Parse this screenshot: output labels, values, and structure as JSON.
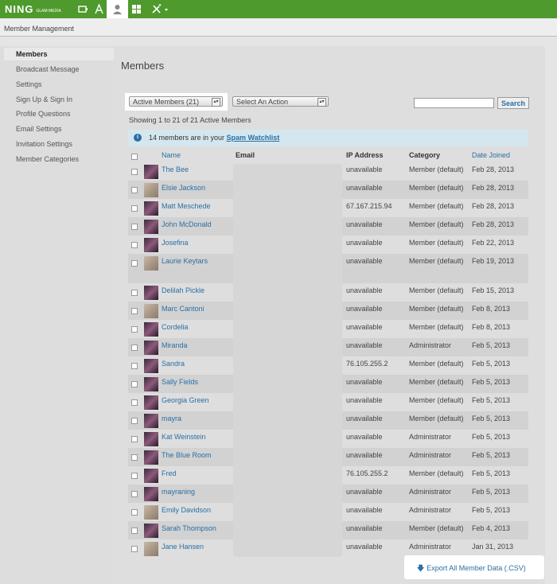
{
  "app": {
    "logo": "NING",
    "logo_sub": "GLAM MEDIA",
    "breadcrumb": "Member Management"
  },
  "sidebar": {
    "items": [
      {
        "label": "Members"
      },
      {
        "label": "Broadcast Message"
      },
      {
        "label": "Settings"
      },
      {
        "label": "Sign Up & Sign In"
      },
      {
        "label": "Profile Questions"
      },
      {
        "label": "Email Settings"
      },
      {
        "label": "Invitation Settings"
      },
      {
        "label": "Member Categories"
      }
    ]
  },
  "main": {
    "title": "Members",
    "filter": {
      "value": "Active Members (21)"
    },
    "action": {
      "value": "Select An Action"
    },
    "search": {
      "placeholder": "",
      "button": "Search"
    },
    "showing": "Showing 1 to 21 of 21 Active Members",
    "info": {
      "text": "14 members are in your ",
      "link": "Spam Watchlist"
    },
    "columns": {
      "name": "Name",
      "email": "Email",
      "ip": "IP Address",
      "category": "Category",
      "date": "Date Joined"
    },
    "members": [
      {
        "name": "The Bee",
        "ip": "unavailable",
        "category": "Member (default)",
        "date": "Feb 28, 2013"
      },
      {
        "name": "Elsie Jackson",
        "ip": "unavailable",
        "category": "Member (default)",
        "date": "Feb 28, 2013"
      },
      {
        "name": "Matt Meschede",
        "ip": "67.167.215.94",
        "category": "Member (default)",
        "date": "Feb 28, 2013"
      },
      {
        "name": "John McDonald",
        "ip": "unavailable",
        "category": "Member (default)",
        "date": "Feb 28, 2013"
      },
      {
        "name": "Josefina",
        "ip": "unavailable",
        "category": "Member (default)",
        "date": "Feb 22, 2013"
      },
      {
        "name": "Laurie Keytars",
        "ip": "unavailable",
        "category": "Member (default)",
        "date": "Feb 19, 2013"
      },
      {
        "name": "Delilah Pickle",
        "ip": "unavailable",
        "category": "Member (default)",
        "date": "Feb 15, 2013"
      },
      {
        "name": "Marc Cantoni",
        "ip": "unavailable",
        "category": "Member (default)",
        "date": "Feb 8, 2013"
      },
      {
        "name": "Cordelia",
        "ip": "unavailable",
        "category": "Member (default)",
        "date": "Feb 8, 2013"
      },
      {
        "name": "Miranda",
        "ip": "unavailable",
        "category": "Administrator",
        "date": "Feb 5, 2013"
      },
      {
        "name": "Sandra",
        "ip": "76.105.255.2",
        "category": "Member (default)",
        "date": "Feb 5, 2013"
      },
      {
        "name": "Sally Fields",
        "ip": "unavailable",
        "category": "Member (default)",
        "date": "Feb 5, 2013"
      },
      {
        "name": "Georgia Green",
        "ip": "unavailable",
        "category": "Member (default)",
        "date": "Feb 5, 2013"
      },
      {
        "name": "mayra",
        "ip": "unavailable",
        "category": "Member (default)",
        "date": "Feb 5, 2013"
      },
      {
        "name": "Kat Weinstein",
        "ip": "unavailable",
        "category": "Administrator",
        "date": "Feb 5, 2013"
      },
      {
        "name": "The Blue Room",
        "ip": "unavailable",
        "category": "Administrator",
        "date": "Feb 5, 2013"
      },
      {
        "name": "Fred",
        "ip": "76.105.255.2",
        "category": "Member (default)",
        "date": "Feb 5, 2013"
      },
      {
        "name": "mayraning",
        "ip": "unavailable",
        "category": "Administrator",
        "date": "Feb 5, 2013"
      },
      {
        "name": "Emily Davidson",
        "ip": "unavailable",
        "category": "Administrator",
        "date": "Feb 5, 2013"
      },
      {
        "name": "Sarah Thompson",
        "ip": "unavailable",
        "category": "Member (default)",
        "date": "Feb 4, 2013"
      },
      {
        "name": "Jane Hansen",
        "ip": "unavailable",
        "category": "Administrator",
        "date": "Jan 31, 2013"
      }
    ],
    "export": "Export All Member Data (.CSV)"
  }
}
